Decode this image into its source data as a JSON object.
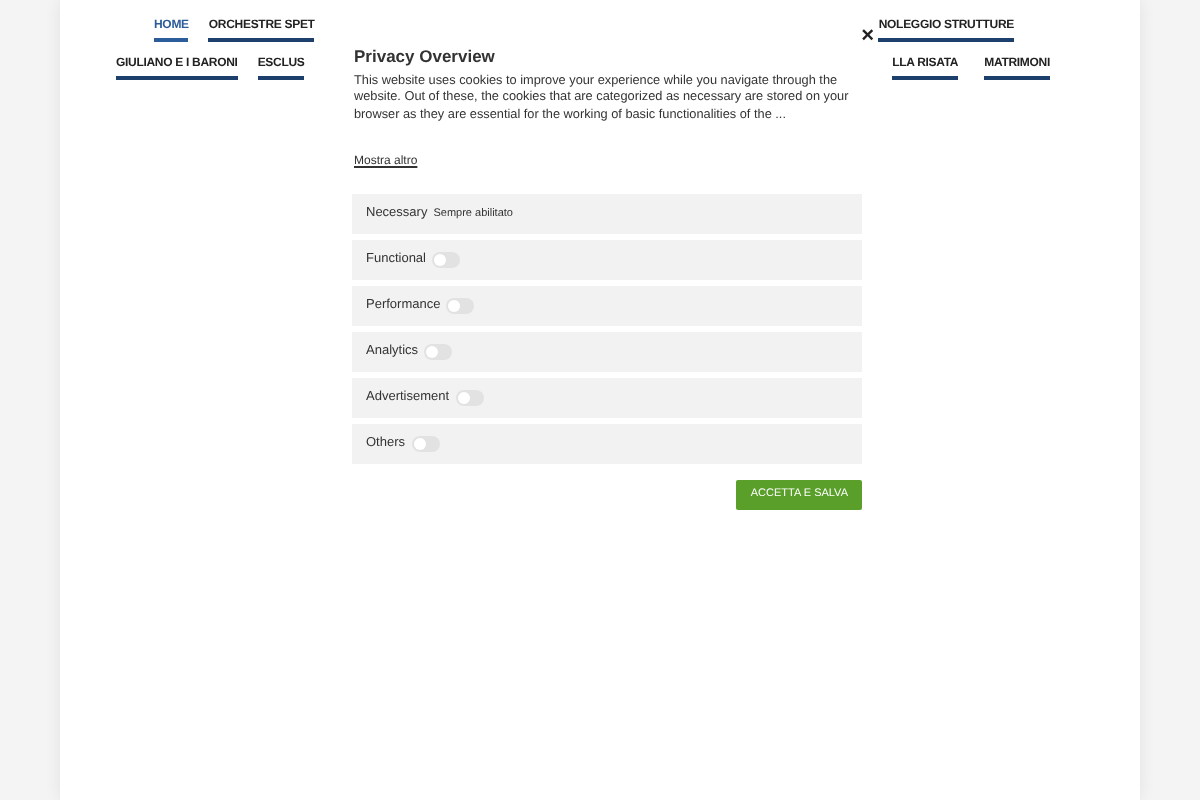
{
  "nav": {
    "row_1": [
      {
        "label": "HOME",
        "selected": true
      },
      {
        "label": "ORCHESTRE SPET",
        "selected": false
      },
      {
        "label": "NOLEGGIO STRUTTURE",
        "selected": false
      }
    ],
    "row_2": [
      {
        "label": "GIULIANO E I BARONI",
        "selected": false
      },
      {
        "label": "ESCLUS",
        "selected": false
      },
      {
        "label": "LLA RISATA",
        "selected": false
      },
      {
        "label": "MATRIMONI",
        "selected": false
      }
    ]
  },
  "modal": {
    "title": "Privacy Overview",
    "close": "×",
    "text": "This website uses cookies to improve your experience while you navigate through the website. Out of these, the cookies that are categorized as necessary are stored on your browser as they are essential for the working of basic functionalities of the ...",
    "more_link": "Mostra altro",
    "categories": [
      {
        "name": "Necessary",
        "kind": "always",
        "status": "Sempre abilitato"
      },
      {
        "name": "Functional",
        "kind": "toggle",
        "on": false
      },
      {
        "name": "Performance",
        "kind": "toggle",
        "on": false
      },
      {
        "name": "Analytics",
        "kind": "toggle",
        "on": false
      },
      {
        "name": "Advertisement",
        "kind": "toggle",
        "on": false
      },
      {
        "name": "Others",
        "kind": "toggle",
        "on": false
      }
    ],
    "save_button": "ACCETTA E SALVA"
  }
}
